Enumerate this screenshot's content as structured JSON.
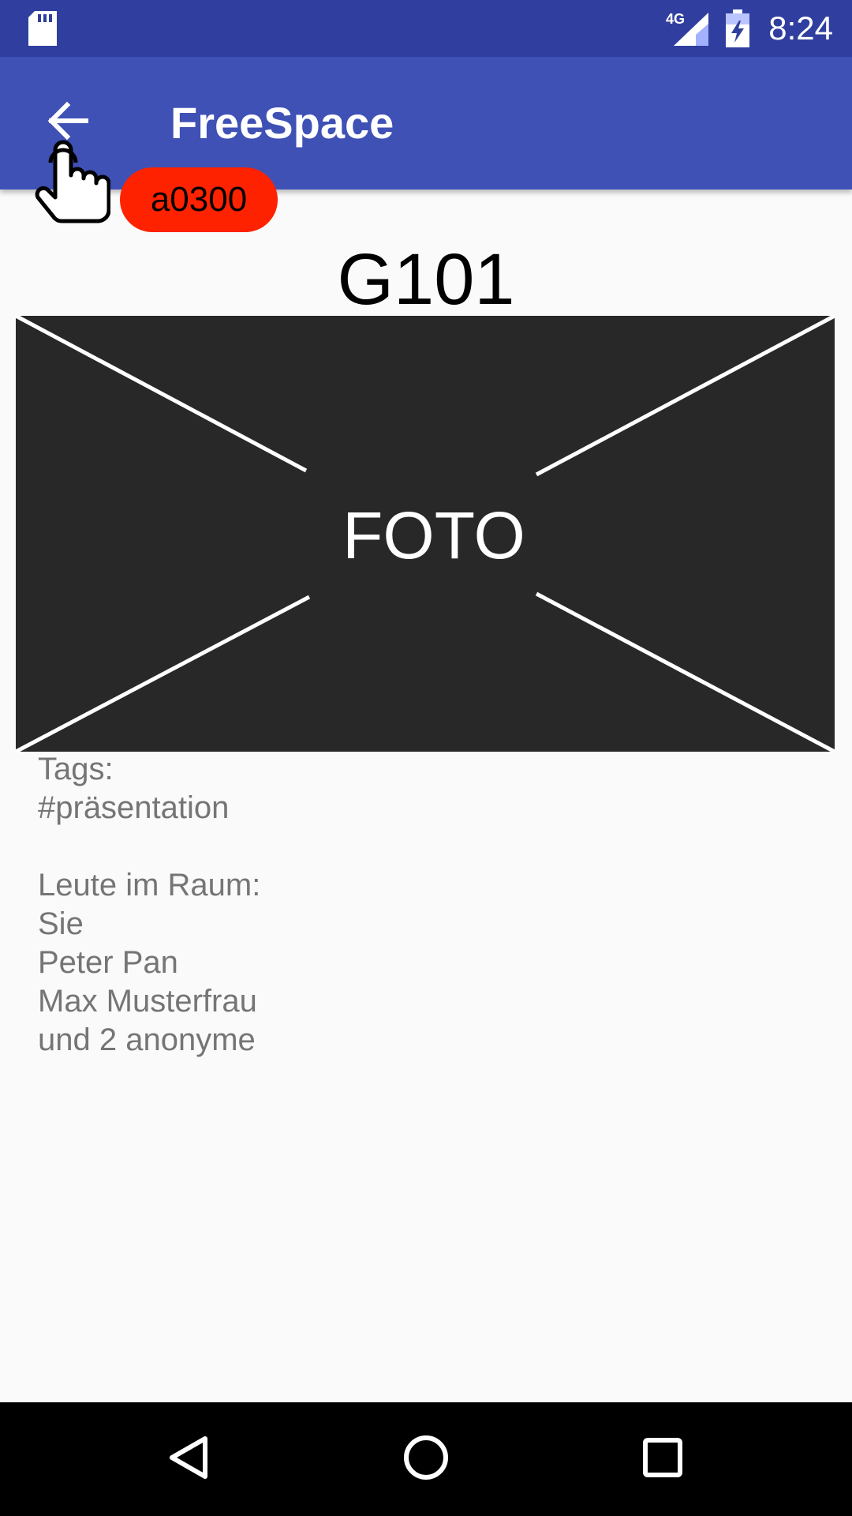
{
  "status_bar": {
    "time": "8:24",
    "network": "4G",
    "icons": [
      "sd-card-icon",
      "signal-icon",
      "battery-charging-icon"
    ]
  },
  "app_bar": {
    "title": "FreeSpace",
    "back_icon": "arrow-back-icon"
  },
  "overlay": {
    "hand_icon": "hand-pointer-icon",
    "badge_label": "a0300",
    "badge_color": "#ff2200"
  },
  "room": {
    "name": "G101",
    "photo_placeholder": "FOTO"
  },
  "details": {
    "tags_heading": "Tags:",
    "tags": [
      "#präsentation"
    ],
    "people_heading": "Leute im Raum:",
    "people": [
      "Sie",
      "Peter Pan",
      "Max Musterfrau",
      "und 2 anonyme"
    ]
  },
  "nav_bar": {
    "icons": [
      "nav-back-icon",
      "nav-home-icon",
      "nav-recents-icon"
    ]
  },
  "colors": {
    "status_bar": "#303f9f",
    "app_bar": "#3f51b5",
    "photo_bg": "#282828",
    "text_secondary": "#757575"
  }
}
